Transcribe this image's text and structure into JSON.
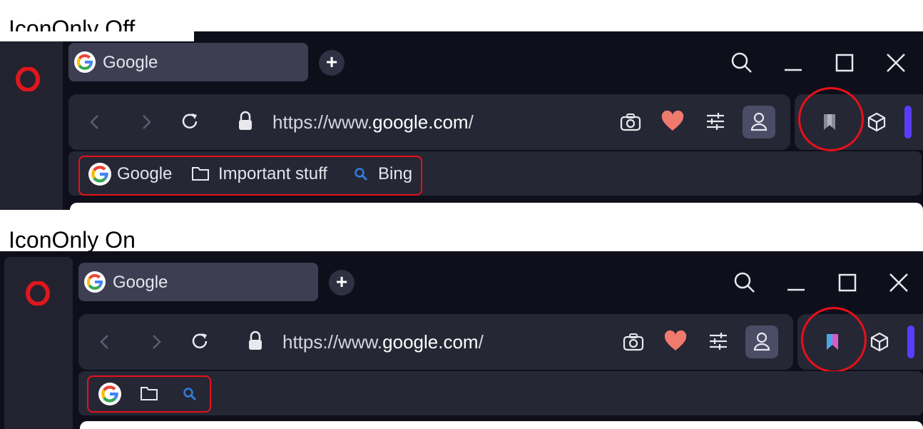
{
  "captions": {
    "off": "IconOnly Off",
    "on": "IconOnly On"
  },
  "browser": {
    "tab_title": "Google",
    "new_tab_symbol": "+",
    "url": {
      "scheme": "https://www.",
      "host": "google.com",
      "path": "/"
    }
  },
  "bookmarks": [
    {
      "label": "Google",
      "icon": "google-icon"
    },
    {
      "label": "Important stuff",
      "icon": "folder-icon"
    },
    {
      "label": "Bing",
      "icon": "search-icon"
    }
  ],
  "colors": {
    "annotation": "#e8101a",
    "opera": "#e0161d",
    "heart": "#f07a6e",
    "accent_bar": "#5b3cff",
    "search_bookmark_icon": "#2f7fe0"
  }
}
